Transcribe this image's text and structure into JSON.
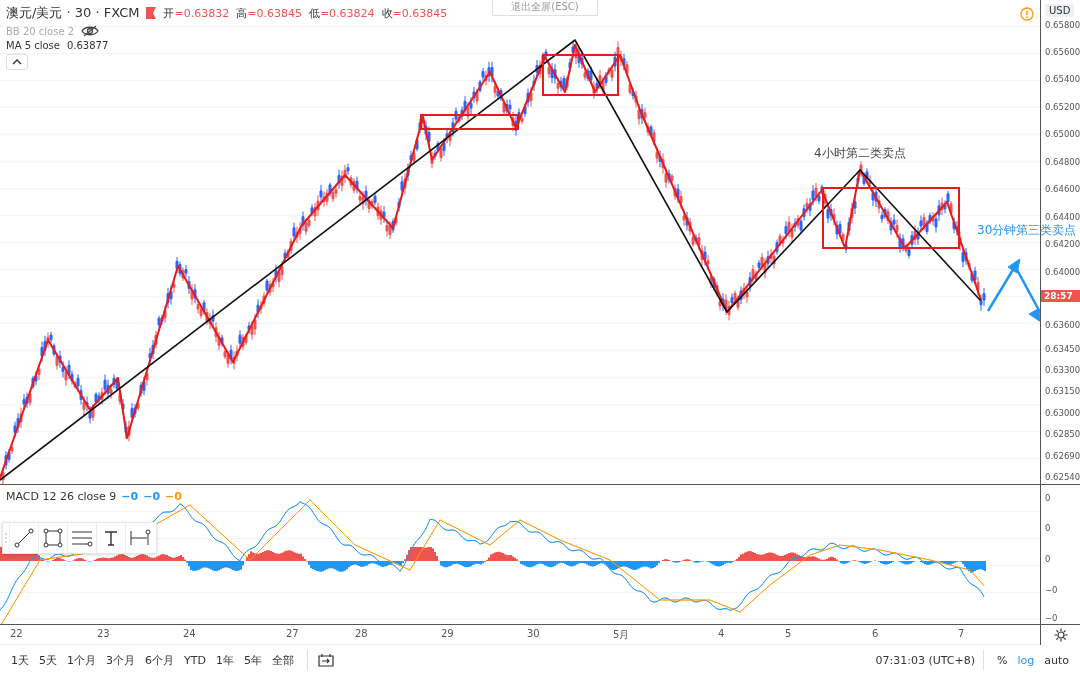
{
  "header": {
    "symbol": "澳元/美元 · 30 · FXCM",
    "ohlc": [
      {
        "label": "开",
        "value": "=0.63832"
      },
      {
        "label": "高",
        "value": "=0.63845"
      },
      {
        "label": "低",
        "value": "=0.63824"
      },
      {
        "label": "收",
        "value": "=0.63845"
      }
    ]
  },
  "indicators": [
    {
      "name": "BB 20 close 2",
      "visible": false
    },
    {
      "name": "MA 5 close",
      "value": "0.63877",
      "visible": true
    }
  ],
  "tooltip": "退出全屏(ESC)",
  "currency": "USD",
  "price_axis": [
    "0.65800",
    "0.65600",
    "0.65400",
    "0.65200",
    "0.65000",
    "0.64800",
    "0.64600",
    "0.64400",
    "0.64200",
    "0.64000",
    "0.63600",
    "0.63450",
    "0.63300",
    "0.63150",
    "0.63000",
    "0.62850",
    "0.62690",
    "0.62540"
  ],
  "countdown": "28:57",
  "annotations": [
    {
      "text": "4小时第二类卖点",
      "kind": "dark"
    },
    {
      "text": "30分钟第三类卖点",
      "kind": "blue"
    }
  ],
  "macd": {
    "legend": "MACD 12 26 close 9",
    "values": [
      {
        "text": "−0",
        "color": "#2196f3"
      },
      {
        "text": "−0",
        "color": "#2196f3"
      },
      {
        "text": "−0",
        "color": "#ff9800"
      }
    ],
    "axis": [
      "0",
      "0",
      "0",
      "−0",
      "−0"
    ]
  },
  "time_axis": [
    "22",
    "23",
    "24",
    "27",
    "28",
    "29",
    "30",
    "5月",
    "4",
    "5",
    "6",
    "7"
  ],
  "ranges": [
    "1天",
    "5天",
    "1个月",
    "3个月",
    "6个月",
    "YTD",
    "1年",
    "5年",
    "全部"
  ],
  "clock": "07:31:03 (UTC+8)",
  "scale_options": [
    {
      "label": "%",
      "selected": false
    },
    {
      "label": "log",
      "selected": true
    },
    {
      "label": "auto",
      "selected": false
    }
  ]
}
